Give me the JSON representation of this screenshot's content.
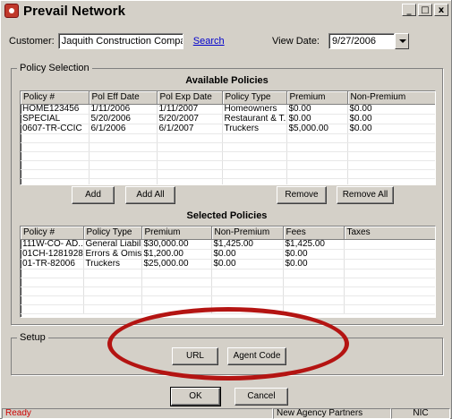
{
  "window": {
    "title": "Prevail Network",
    "icon": "prevail-app-icon",
    "controls": {
      "minimize": "_",
      "maximize": "□",
      "close": "x"
    }
  },
  "customer": {
    "label": "Customer:",
    "value": "Jaquith Construction Company",
    "search_link": "Search"
  },
  "view_date": {
    "label": "View Date:",
    "value": "9/27/2006"
  },
  "policy_selection": {
    "legend": "Policy Selection",
    "available": {
      "title": "Available Policies",
      "columns": [
        "Policy #",
        "Pol Eff Date",
        "Pol Exp Date",
        "Policy Type",
        "Premium",
        "Non-Premium"
      ],
      "rows": [
        [
          "HOME123456",
          "1/11/2006",
          "1/11/2007",
          "Homeowners",
          "$0.00",
          "$0.00"
        ],
        [
          "SPECIAL",
          "5/20/2006",
          "5/20/2007",
          "Restaurant & T...",
          "$0.00",
          "$0.00"
        ],
        [
          "0607-TR-CCIC",
          "6/1/2006",
          "6/1/2007",
          "Truckers",
          "$5,000.00",
          "$0.00"
        ]
      ]
    },
    "buttons": {
      "add": "Add",
      "add_all": "Add All",
      "remove": "Remove",
      "remove_all": "Remove All"
    },
    "selected": {
      "title": "Selected Policies",
      "columns": [
        "Policy #",
        "Policy Type",
        "Premium",
        "Non-Premium",
        "Fees",
        "Taxes"
      ],
      "rows": [
        [
          "111W-CO- AD...",
          "General Liability",
          "$30,000.00",
          "$1,425.00",
          "$1,425.00",
          ""
        ],
        [
          "01CH-1281928",
          "Errors & Omissi...",
          "$1,200.00",
          "$0.00",
          "$0.00",
          ""
        ],
        [
          "01-TR-82006",
          "Truckers",
          "$25,000.00",
          "$0.00",
          "$0.00",
          ""
        ]
      ]
    }
  },
  "setup": {
    "legend": "Setup",
    "url_button": "URL",
    "agent_code_button": "Agent Code"
  },
  "footer": {
    "ok": "OK",
    "cancel": "Cancel"
  },
  "statusbar": {
    "status": "Ready",
    "agency": "New Agency Partners",
    "code": "NIC"
  },
  "colors": {
    "status_ready": "#cc0000",
    "annotation": "#b41412",
    "link": "#0000cc"
  }
}
